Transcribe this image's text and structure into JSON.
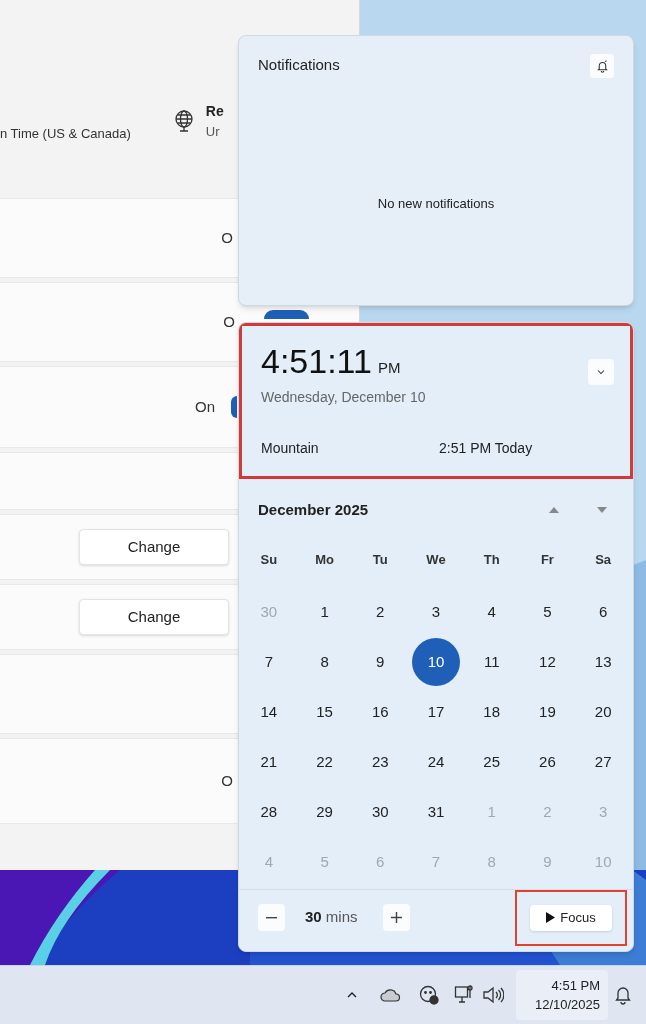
{
  "settings_window": {
    "header": {
      "timezone_text": "n Time (US & Canada)",
      "region_title": "Re",
      "region_value": "Ur"
    },
    "rows": [
      {
        "kind": "value",
        "text": "O"
      },
      {
        "kind": "toggle",
        "text": "O",
        "on": true
      },
      {
        "kind": "toggle",
        "text": "On",
        "on": true
      },
      {
        "kind": "empty"
      },
      {
        "kind": "button",
        "text": "Change"
      },
      {
        "kind": "button",
        "text": "Change"
      },
      {
        "kind": "empty"
      },
      {
        "kind": "value",
        "text": "O"
      }
    ]
  },
  "notifications": {
    "title": "Notifications",
    "empty_text": "No new notifications"
  },
  "clock": {
    "time": "4:51:11",
    "ampm": "PM",
    "date": "Wednesday, December 10",
    "zone": "Mountain",
    "zone_time": "2:51 PM Today",
    "highlighted": true
  },
  "calendar": {
    "month": "December 2025",
    "weekdays": [
      "Su",
      "Mo",
      "Tu",
      "We",
      "Th",
      "Fr",
      "Sa"
    ],
    "weeks": [
      [
        {
          "text": "30",
          "in_month": false,
          "selected": false
        },
        {
          "text": "1",
          "in_month": true,
          "selected": false
        },
        {
          "text": "2",
          "in_month": true,
          "selected": false
        },
        {
          "text": "3",
          "in_month": true,
          "selected": false
        },
        {
          "text": "4",
          "in_month": true,
          "selected": false
        },
        {
          "text": "5",
          "in_month": true,
          "selected": false
        },
        {
          "text": "6",
          "in_month": true,
          "selected": false
        }
      ],
      [
        {
          "text": "7",
          "in_month": true,
          "selected": false
        },
        {
          "text": "8",
          "in_month": true,
          "selected": false
        },
        {
          "text": "9",
          "in_month": true,
          "selected": false
        },
        {
          "text": "10",
          "in_month": true,
          "selected": true
        },
        {
          "text": "11",
          "in_month": true,
          "selected": false
        },
        {
          "text": "12",
          "in_month": true,
          "selected": false
        },
        {
          "text": "13",
          "in_month": true,
          "selected": false
        }
      ],
      [
        {
          "text": "14",
          "in_month": true,
          "selected": false
        },
        {
          "text": "15",
          "in_month": true,
          "selected": false
        },
        {
          "text": "16",
          "in_month": true,
          "selected": false
        },
        {
          "text": "17",
          "in_month": true,
          "selected": false
        },
        {
          "text": "18",
          "in_month": true,
          "selected": false
        },
        {
          "text": "19",
          "in_month": true,
          "selected": false
        },
        {
          "text": "20",
          "in_month": true,
          "selected": false
        }
      ],
      [
        {
          "text": "21",
          "in_month": true,
          "selected": false
        },
        {
          "text": "22",
          "in_month": true,
          "selected": false
        },
        {
          "text": "23",
          "in_month": true,
          "selected": false
        },
        {
          "text": "24",
          "in_month": true,
          "selected": false
        },
        {
          "text": "25",
          "in_month": true,
          "selected": false
        },
        {
          "text": "26",
          "in_month": true,
          "selected": false
        },
        {
          "text": "27",
          "in_month": true,
          "selected": false
        }
      ],
      [
        {
          "text": "28",
          "in_month": true,
          "selected": false
        },
        {
          "text": "29",
          "in_month": true,
          "selected": false
        },
        {
          "text": "30",
          "in_month": true,
          "selected": false
        },
        {
          "text": "31",
          "in_month": true,
          "selected": false
        },
        {
          "text": "1",
          "in_month": false,
          "selected": false
        },
        {
          "text": "2",
          "in_month": false,
          "selected": false
        },
        {
          "text": "3",
          "in_month": false,
          "selected": false
        }
      ],
      [
        {
          "text": "4",
          "in_month": false,
          "selected": false
        },
        {
          "text": "5",
          "in_month": false,
          "selected": false
        },
        {
          "text": "6",
          "in_month": false,
          "selected": false
        },
        {
          "text": "7",
          "in_month": false,
          "selected": false
        },
        {
          "text": "8",
          "in_month": false,
          "selected": false
        },
        {
          "text": "9",
          "in_month": false,
          "selected": false
        },
        {
          "text": "10",
          "in_month": false,
          "selected": false
        }
      ]
    ]
  },
  "focus": {
    "minutes": "30",
    "unit": "mins",
    "button": "Focus",
    "highlighted": true
  },
  "taskbar": {
    "time": "4:51 PM",
    "date": "12/10/2025"
  }
}
